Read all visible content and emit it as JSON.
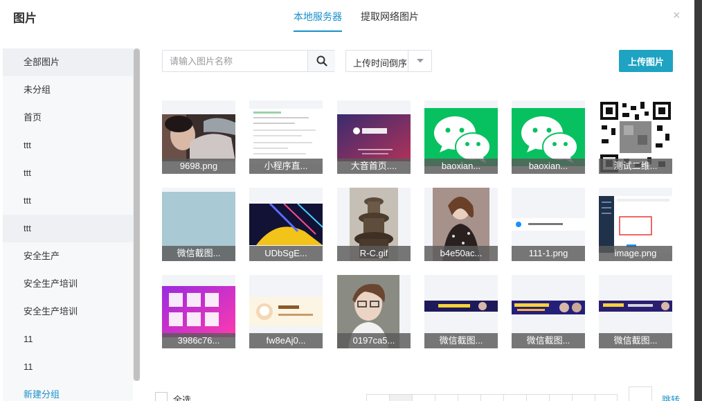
{
  "dialog": {
    "title": "图片",
    "tabs": [
      {
        "label": "本地服务器",
        "active": true
      },
      {
        "label": "提取网络图片",
        "active": false
      }
    ],
    "close_label": "×"
  },
  "sidebar": {
    "items": [
      {
        "label": "全部图片"
      },
      {
        "label": "未分组"
      },
      {
        "label": "首页"
      },
      {
        "label": "ttt"
      },
      {
        "label": "ttt"
      },
      {
        "label": "ttt"
      },
      {
        "label": "ttt"
      },
      {
        "label": "安全生产"
      },
      {
        "label": "安全生产培训"
      },
      {
        "label": "安全生产培训"
      },
      {
        "label": "11"
      },
      {
        "label": "11"
      }
    ],
    "new_group": "新建分组"
  },
  "toolbar": {
    "search_placeholder": "请输入图片名称",
    "sort_value": "上传时间倒序",
    "upload_label": "上传图片"
  },
  "images": [
    {
      "name": "9698.png"
    },
    {
      "name": "小程序直..."
    },
    {
      "name": "大音首页...."
    },
    {
      "name": "baoxian..."
    },
    {
      "name": "baoxian..."
    },
    {
      "name": "测试二维..."
    },
    {
      "name": "微信截图..."
    },
    {
      "name": "UDbSgE..."
    },
    {
      "name": "R-C.gif"
    },
    {
      "name": "b4e50ac..."
    },
    {
      "name": "111-1.png"
    },
    {
      "name": "image.png"
    },
    {
      "name": "3986c76..."
    },
    {
      "name": "fw8eAj0..."
    },
    {
      "name": "0197ca5..."
    },
    {
      "name": "微信截图..."
    },
    {
      "name": "微信截图..."
    },
    {
      "name": "微信截图..."
    }
  ],
  "footer": {
    "select_all": "全选",
    "jump_label": "跳转"
  },
  "colors": {
    "accent": "#1890c8",
    "upload_button": "#1ea3c2",
    "wechat_green": "#07c160"
  }
}
